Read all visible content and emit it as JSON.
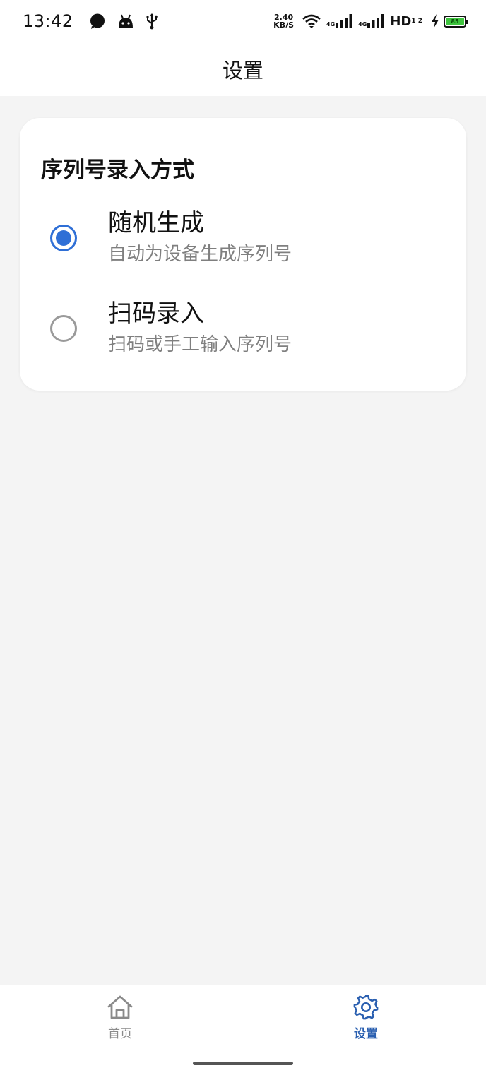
{
  "status_bar": {
    "time": "13:42",
    "net_speed_value": "2.40",
    "net_speed_unit": "KB/S",
    "sim1_label": "4G",
    "sim2_label": "4G",
    "hd_label": "HD",
    "hd_sup": "1 2",
    "battery_level": "85"
  },
  "header": {
    "title": "设置"
  },
  "card": {
    "title": "序列号录入方式",
    "options": [
      {
        "label": "随机生成",
        "description": "自动为设备生成序列号",
        "selected": true
      },
      {
        "label": "扫码录入",
        "description": "扫码或手工输入序列号",
        "selected": false
      }
    ]
  },
  "bottom_nav": {
    "items": [
      {
        "label": "首页",
        "icon": "home-icon",
        "active": false
      },
      {
        "label": "设置",
        "icon": "gear-icon",
        "active": true
      }
    ]
  },
  "colors": {
    "accent": "#2f6fd6",
    "nav_active": "#2a5fb0",
    "background": "#f4f4f4"
  }
}
